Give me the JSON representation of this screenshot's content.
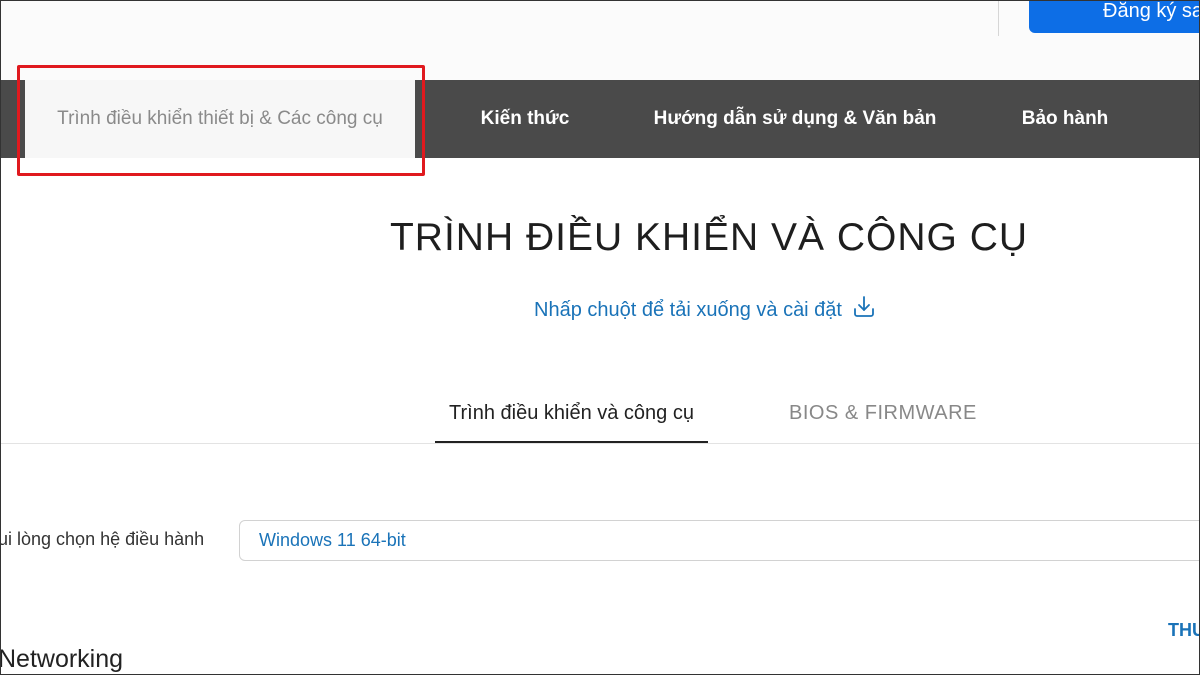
{
  "header": {
    "signup_label": "Đăng ký sa"
  },
  "nav": {
    "tabs": [
      {
        "label": "Trình điều khiển thiết bị & Các công cụ",
        "active": true
      },
      {
        "label": "Kiến thức"
      },
      {
        "label": "Hướng dẫn sử dụng & Văn bản"
      },
      {
        "label": "Bảo hành"
      }
    ]
  },
  "main": {
    "title": "TRÌNH ĐIỀU KHIỂN VÀ CÔNG CỤ",
    "download_link": "Nhấp chuột để tải xuống và cài đặt",
    "subtabs": [
      {
        "label": "Trình điều khiển và công cụ",
        "active": true
      },
      {
        "label": "BIOS & FIRMWARE"
      }
    ],
    "os_label": "ui lòng chọn hệ điều hành",
    "os_value": "Windows 11 64-bit",
    "thu_link": "THU",
    "section_heading": "Networking"
  },
  "colors": {
    "accent": "#1a73b8",
    "primary_button": "#0d6ee6",
    "nav_bg": "#4a4a4a",
    "highlight": "#e0191e"
  }
}
